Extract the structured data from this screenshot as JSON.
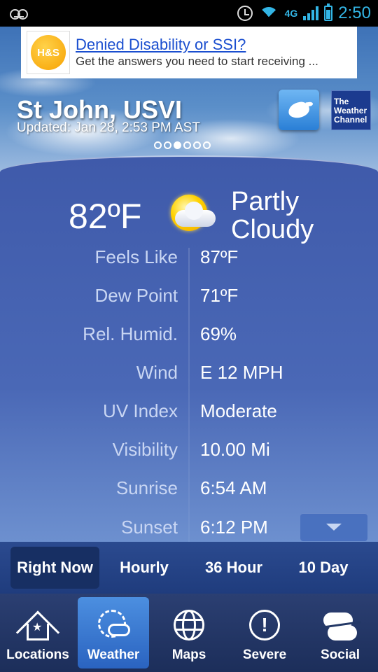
{
  "status_bar": {
    "time": "2:50",
    "network": "4G"
  },
  "ad": {
    "logo_text": "H&S",
    "title": "Denied Disability or SSI?",
    "description": "Get the answers you need to start receiving ..."
  },
  "header": {
    "location": "St John, USVI",
    "updated": "Updated: Jan 28, 2:53 PM AST",
    "brand_line1": "The",
    "brand_line2": "Weather",
    "brand_line3": "Channel",
    "page_index": 2,
    "page_count": 6
  },
  "current": {
    "temperature": "82ºF",
    "condition": "Partly Cloudy",
    "condition_icon": "partly-cloudy-icon"
  },
  "details": [
    {
      "label": "Feels Like",
      "value": "87ºF"
    },
    {
      "label": "Dew Point",
      "value": "71ºF"
    },
    {
      "label": "Rel. Humid.",
      "value": "69%"
    },
    {
      "label": "Wind",
      "value": "E 12 MPH"
    },
    {
      "label": "UV Index",
      "value": "Moderate"
    },
    {
      "label": "Visibility",
      "value": "10.00 Mi"
    },
    {
      "label": "Sunrise",
      "value": "6:54 AM"
    },
    {
      "label": "Sunset",
      "value": "6:12 PM"
    }
  ],
  "period_tabs": [
    {
      "label": "Right Now",
      "active": true
    },
    {
      "label": "Hourly",
      "active": false
    },
    {
      "label": "36 Hour",
      "active": false
    },
    {
      "label": "10 Day",
      "active": false
    }
  ],
  "nav": [
    {
      "label": "Locations",
      "icon": "home-star-icon",
      "active": false
    },
    {
      "label": "Weather",
      "icon": "sun-cloud-icon",
      "active": true
    },
    {
      "label": "Maps",
      "icon": "globe-icon",
      "active": false
    },
    {
      "label": "Severe",
      "icon": "alert-icon",
      "active": false
    },
    {
      "label": "Social",
      "icon": "social-cloud-icon",
      "active": false
    }
  ],
  "colors": {
    "accent": "#33b5e5",
    "panel": "#4a68b6",
    "ad_link": "#1a4ecf"
  }
}
